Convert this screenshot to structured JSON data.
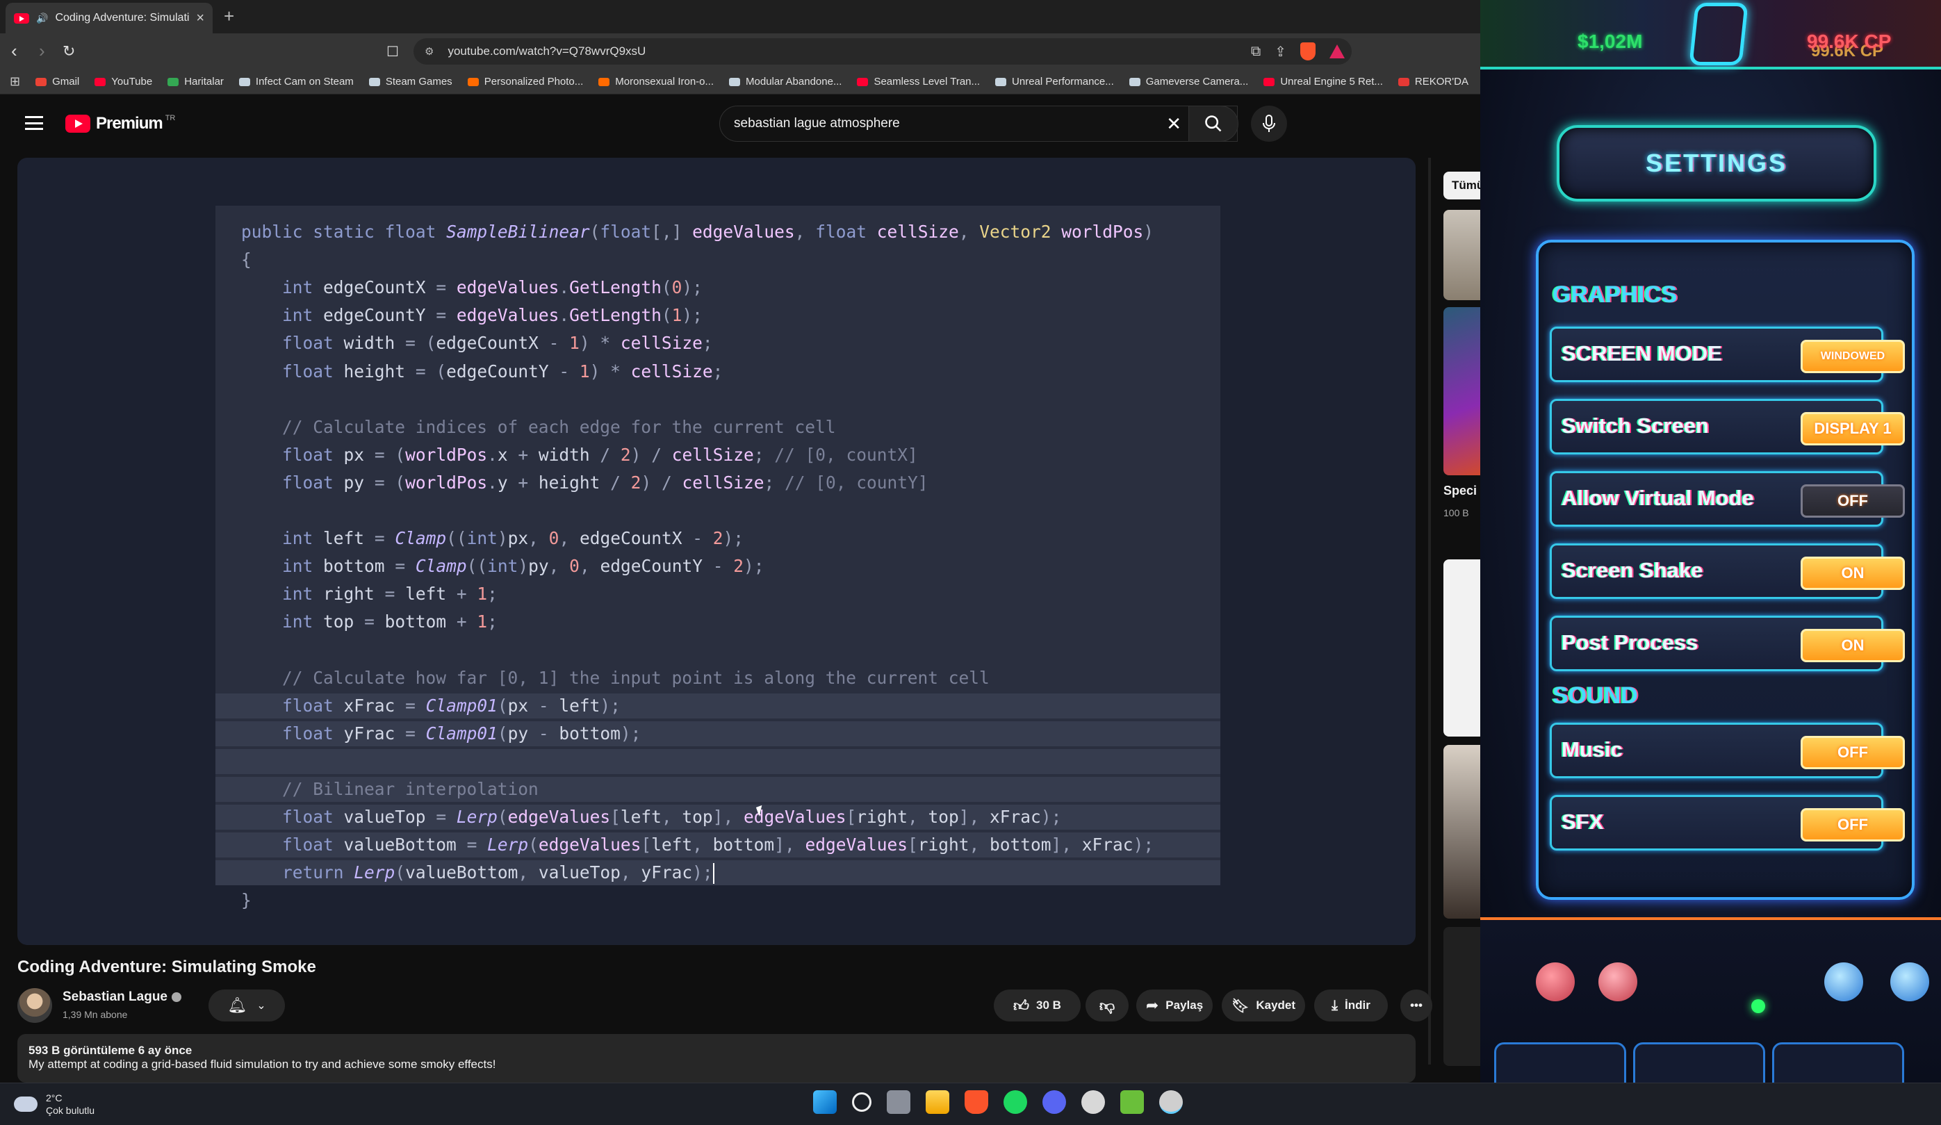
{
  "browser": {
    "tab": {
      "title": "Coding Adventure: Simulating Smoke",
      "close": "×"
    },
    "newtab": "+",
    "url": "youtube.com/watch?v=Q78wvrQ9xsU",
    "bookmarks": [
      {
        "label": "Gmail",
        "color": "#ea4335"
      },
      {
        "label": "YouTube",
        "color": "#ff0033"
      },
      {
        "label": "Haritalar",
        "color": "#34a853"
      },
      {
        "label": "Infect Cam on Steam",
        "color": "#c6d4df"
      },
      {
        "label": "Steam Games",
        "color": "#c6d4df"
      },
      {
        "label": "Personalized Photo...",
        "color": "#ff6a00"
      },
      {
        "label": "Moronsexual Iron-o...",
        "color": "#ff6a00"
      },
      {
        "label": "Modular Abandone...",
        "color": "#c6d4df"
      },
      {
        "label": "Seamless Level Tran...",
        "color": "#ff0033"
      },
      {
        "label": "Unreal Performance...",
        "color": "#c6d4df"
      },
      {
        "label": "Gameverse Camera...",
        "color": "#c6d4df"
      },
      {
        "label": "Unreal Engine 5 Ret...",
        "color": "#ff0033"
      },
      {
        "label": "REKOR'DA",
        "color": "#e53935"
      }
    ]
  },
  "youtube": {
    "logo": "Premium",
    "region": "TR",
    "search": {
      "value": "sebastian lague atmosphere"
    },
    "video_title": "Coding Adventure: Simulating Smoke",
    "channel": {
      "name": "Sebastian Lague",
      "subs": "1,39 Mn abone"
    },
    "actions": {
      "likes": "30 B",
      "share": "Paylaş",
      "save": "Kaydet",
      "download": "İndir"
    },
    "description": {
      "meta": "593 B görüntüleme  6 ay önce",
      "text": "My attempt at coding a grid-based fluid simulation to try and achieve some smoky effects!"
    },
    "rail": {
      "chip": "Tümü",
      "video_title": "Speci",
      "views": "100 B"
    }
  },
  "code_lines": [
    "public static float SampleBilinear(float[,] edgeValues, float cellSize, Vector2 worldPos)",
    "{",
    "    int edgeCountX = edgeValues.GetLength(0);",
    "    int edgeCountY = edgeValues.GetLength(1);",
    "    float width = (edgeCountX - 1) * cellSize;",
    "    float height = (edgeCountY - 1) * cellSize;",
    "",
    "    // Calculate indices of each edge for the current cell",
    "    float px = (worldPos.x + width / 2) / cellSize; // [0, countX]",
    "    float py = (worldPos.y + height / 2) / cellSize; // [0, countY]",
    "",
    "    int left = Clamp((int)px, 0, edgeCountX - 2);",
    "    int bottom = Clamp((int)py, 0, edgeCountY - 2);",
    "    int right = left + 1;",
    "    int top = bottom + 1;",
    "",
    "    // Calculate how far [0, 1] the input point is along the current cell",
    "    float xFrac = Clamp01(px - left);",
    "    float yFrac = Clamp01(py - bottom);",
    "",
    "    // Bilinear interpolation",
    "    float valueTop = Lerp(edgeValues[left, top], edgeValues[right, top], xFrac);",
    "    float valueBottom = Lerp(edgeValues[left, bottom], edgeValues[right, bottom], xFrac);",
    "    return Lerp(valueBottom, valueTop, yFrac);",
    "}"
  ],
  "taskbar": {
    "temp": "2°C",
    "condition": "Çok bulutlu"
  },
  "game": {
    "money": "$1,02M",
    "cp_primary": "99.6K CP",
    "cp_secondary": "99.6K CP",
    "title": "SETTINGS",
    "graphics_label": "GRAPHICS",
    "sound_label": "SOUND",
    "rows": [
      {
        "label": "SCREEN MODE",
        "value": "WINDOWED",
        "style": "on"
      },
      {
        "label": "Switch Screen",
        "value": "DISPLAY 1",
        "style": "on"
      },
      {
        "label": "Allow Virtual Mode",
        "value": "OFF",
        "style": "dark"
      },
      {
        "label": "Screen Shake",
        "value": "ON",
        "style": "on"
      },
      {
        "label": "Post Process",
        "value": "ON",
        "style": "on"
      },
      {
        "label": "Music",
        "value": "OFF",
        "style": "on"
      },
      {
        "label": "SFX",
        "value": "OFF",
        "style": "on"
      }
    ]
  }
}
